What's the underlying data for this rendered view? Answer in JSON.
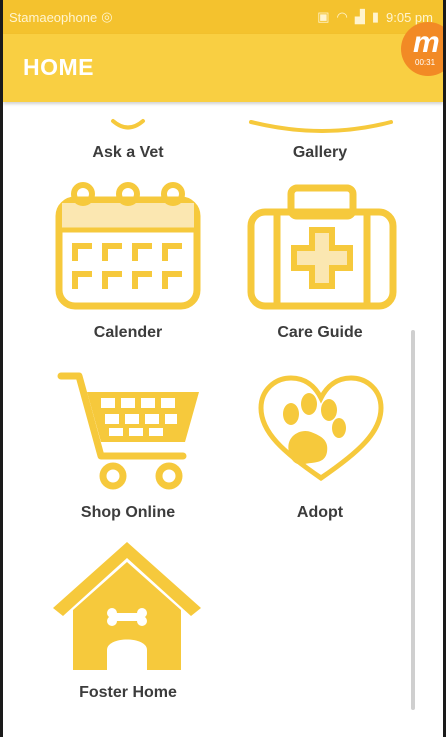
{
  "status_bar": {
    "carrier": "Stamaeophone",
    "time": "9:05 pm"
  },
  "app_bar": {
    "title": "HOME"
  },
  "recorder": {
    "letter": "m",
    "time": "00:31"
  },
  "menu": {
    "ask_vet": "Ask a Vet",
    "gallery": "Gallery",
    "calender": "Calender",
    "care_guide": "Care Guide",
    "shop_online": "Shop Online",
    "adopt": "Adopt",
    "foster_home": "Foster Home"
  },
  "colors": {
    "accent": "#f9cf42",
    "icon": "#f6c93c",
    "text": "#3c3c3c"
  }
}
